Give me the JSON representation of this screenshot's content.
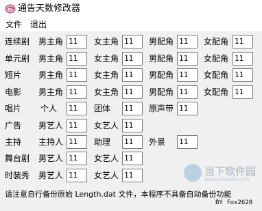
{
  "window": {
    "title": "通告天数修改器"
  },
  "menu": {
    "file": "文件",
    "exit": "退出"
  },
  "rows": [
    {
      "category": "连续剧",
      "fields": [
        {
          "label": "男主角",
          "value": "11"
        },
        {
          "label": "女主角",
          "value": "11"
        },
        {
          "label": "男配角",
          "value": "11"
        },
        {
          "label": "女配角",
          "value": "11"
        }
      ]
    },
    {
      "category": "单元剧",
      "fields": [
        {
          "label": "男主角",
          "value": "11"
        },
        {
          "label": "女主角",
          "value": "11"
        },
        {
          "label": "男配角",
          "value": "11"
        },
        {
          "label": "女配角",
          "value": "11"
        }
      ]
    },
    {
      "category": "短片",
      "fields": [
        {
          "label": "男主角",
          "value": "11"
        },
        {
          "label": "女主角",
          "value": "11"
        },
        {
          "label": "男配角",
          "value": "11"
        },
        {
          "label": "女配角",
          "value": "11"
        }
      ]
    },
    {
      "category": "电影",
      "fields": [
        {
          "label": "男主角",
          "value": "11"
        },
        {
          "label": "女主角",
          "value": "11"
        },
        {
          "label": "男配角",
          "value": "11"
        },
        {
          "label": "女配角",
          "value": "11"
        }
      ]
    },
    {
      "category": "唱片",
      "fields": [
        {
          "label": "个人",
          "value": "11"
        },
        {
          "label": "团体",
          "value": "11"
        },
        {
          "label": "原声带",
          "value": "11"
        }
      ]
    },
    {
      "category": "广告",
      "fields": [
        {
          "label": "男艺人",
          "value": "11"
        },
        {
          "label": "女艺人",
          "value": "11"
        }
      ]
    },
    {
      "category": "主持",
      "fields": [
        {
          "label": "主持人",
          "value": "11"
        },
        {
          "label": "助理",
          "value": "11"
        },
        {
          "label": "外景",
          "value": "11"
        }
      ]
    },
    {
      "category": "舞台剧",
      "fields": [
        {
          "label": "男艺人",
          "value": "11"
        },
        {
          "label": "女艺人",
          "value": "11"
        }
      ]
    },
    {
      "category": "时装秀",
      "fields": [
        {
          "label": "男艺人",
          "value": "11"
        },
        {
          "label": "女艺人",
          "value": "11"
        }
      ]
    }
  ],
  "footer": {
    "notice": "请注意自行备份原始 Length.dat 文件，本程序不具备自动备份功能",
    "credit": "BY fox2628"
  },
  "watermark": {
    "text": "当下软件园",
    "sub": "www.downxia.com"
  }
}
